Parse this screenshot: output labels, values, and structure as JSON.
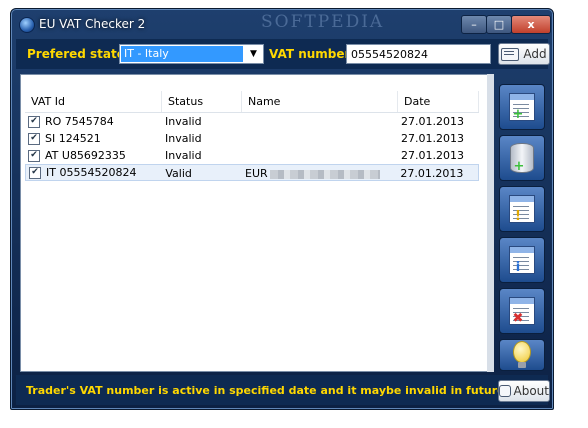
{
  "window": {
    "title": "EU VAT Checker 2",
    "watermark": "SOFTPEDIA",
    "controls": {
      "minimize": "–",
      "maximize": "□",
      "close": "x"
    }
  },
  "toolbar": {
    "state_label": "Prefered state:",
    "state_value": "IT - Italy",
    "vat_label": "VAT number:",
    "vat_value": "05554520824",
    "add_label": "Add"
  },
  "table": {
    "columns": [
      "VAT Id",
      "Status",
      "Name",
      "Date"
    ],
    "rows": [
      {
        "checked": true,
        "vat_id": "RO 7545784",
        "status": "Invalid",
        "name": "",
        "date": "27.01.2013"
      },
      {
        "checked": true,
        "vat_id": "SI 124521",
        "status": "Invalid",
        "name": "",
        "date": "27.01.2013"
      },
      {
        "checked": true,
        "vat_id": "AT U85692335",
        "status": "Invalid",
        "name": "",
        "date": "27.01.2013"
      },
      {
        "checked": true,
        "vat_id": "IT 05554520824",
        "status": "Valid",
        "name": "EUR",
        "date": "27.01.2013"
      }
    ]
  },
  "sidebar": {
    "buttons": [
      "new-document-icon",
      "database-add-icon",
      "document-warning-icon",
      "document-info-icon",
      "document-delete-icon",
      "lightbulb-icon"
    ]
  },
  "status": {
    "message": "Trader's VAT number is active in specified date and it maybe invalid in future.",
    "about_label": "About"
  },
  "colors": {
    "frame": "#0e2a52",
    "label_yellow": "#ffd800",
    "selection_blue": "#3399ff"
  }
}
